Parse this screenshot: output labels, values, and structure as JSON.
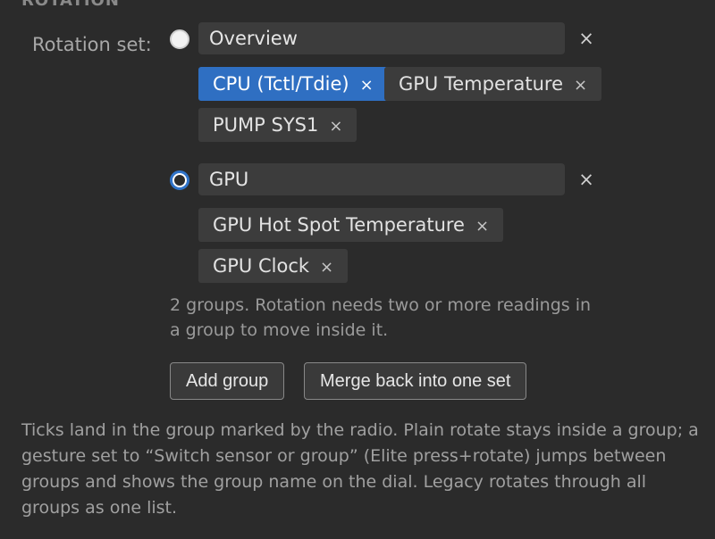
{
  "section": {
    "heading": "ROTATION"
  },
  "rotation_set": {
    "label": "Rotation set:",
    "groups": [
      {
        "name": "Overview",
        "selected": false,
        "remove_glyph": "×",
        "chips": [
          {
            "label": "CPU (Tctl/Tdie)",
            "active": true,
            "remove_glyph": "×"
          },
          {
            "label": "GPU Temperature",
            "active": false,
            "remove_glyph": "×"
          },
          {
            "label": "PUMP SYS1",
            "active": false,
            "remove_glyph": "×"
          }
        ]
      },
      {
        "name": "GPU",
        "selected": true,
        "remove_glyph": "×",
        "chips": [
          {
            "label": "GPU Hot Spot Temperature",
            "active": false,
            "remove_glyph": "×"
          },
          {
            "label": "GPU Clock",
            "active": false,
            "remove_glyph": "×"
          }
        ]
      }
    ],
    "hint": "2 groups. Rotation needs two or more readings in a group to move inside it.",
    "buttons": {
      "add_group": "Add group",
      "merge": "Merge back into one set"
    }
  },
  "footnote": "Ticks land in the group marked by the radio. Plain rotate stays inside a group; a gesture set to “Switch sensor or group” (Elite press+rotate) jumps between groups and shows the group name on the dial. Legacy rotates through all groups as one list.",
  "colors": {
    "background": "#2b2b2b",
    "accent": "#2f6fc2",
    "input_bg": "#3c3c3c",
    "chip_bg": "#3c3c3c"
  },
  "icons": {
    "radio_unselected": "radio-unselected-icon",
    "radio_selected": "radio-selected-icon",
    "remove": "close-icon"
  }
}
